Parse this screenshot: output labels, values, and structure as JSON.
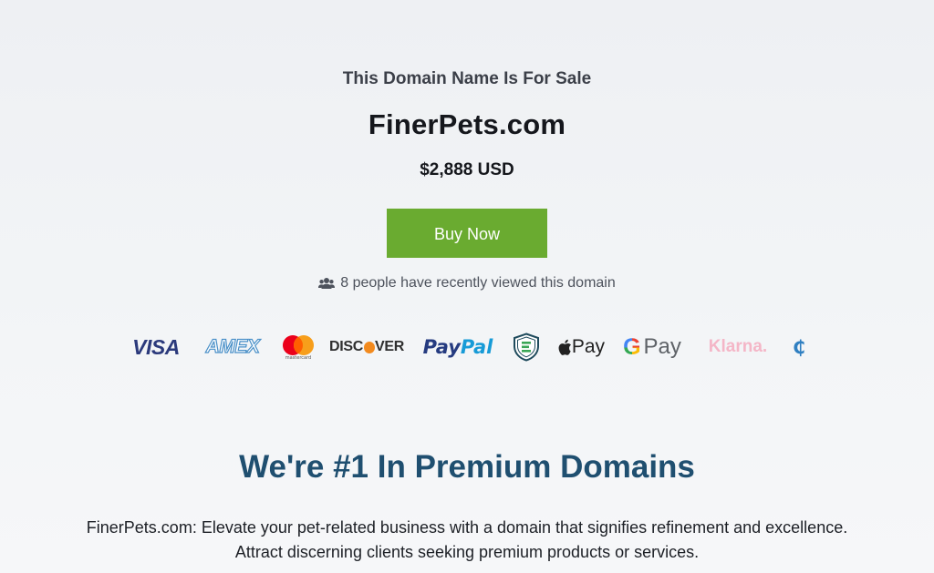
{
  "hero": {
    "kicker": "This Domain Name Is For Sale",
    "domain": "FinerPets.com",
    "price": "$2,888 USD",
    "buy_label": "Buy Now",
    "viewers_text": "8 people have recently viewed this domain",
    "button_color": "#6aab30"
  },
  "payment_methods": {
    "visa": "VISA",
    "amex": "AMEX",
    "mastercard": "mastercard",
    "discover_left": "DISC",
    "discover_right": "VER",
    "paypal_part1": "Pay",
    "paypal_part2": "Pal",
    "escrow_icon": "escrow-shield-icon",
    "applepay_text": "Pay",
    "gpay_g": "G",
    "gpay_text": "Pay",
    "klarna": "Klarna.",
    "crypto": "₵"
  },
  "section": {
    "headline": "We're #1 In Premium Domains",
    "desc_line1": "FinerPets.com: Elevate your pet-related business with a domain that signifies refinement and excellence.",
    "desc_line2": "Attract discerning clients seeking premium products or services.",
    "headline_color": "#1f4f70"
  }
}
